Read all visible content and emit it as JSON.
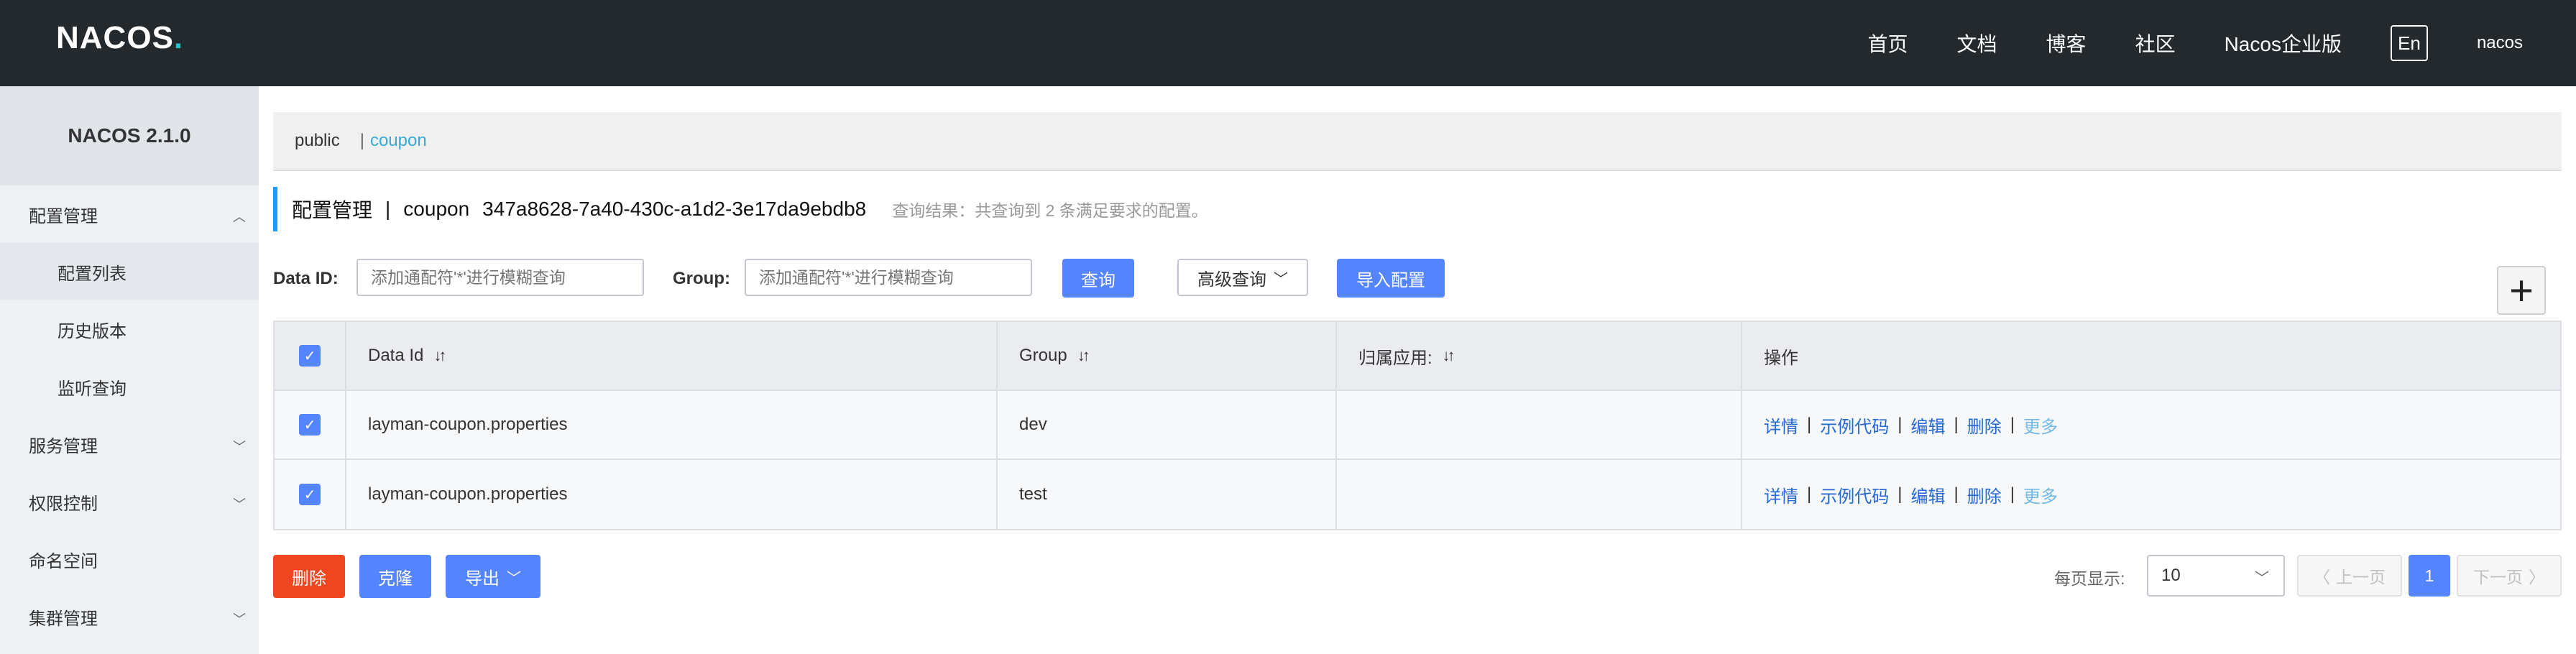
{
  "brand": {
    "logo_text": "NACOS",
    "logo_dot": "."
  },
  "topnav": {
    "items": [
      "首页",
      "文档",
      "博客",
      "社区",
      "Nacos企业版"
    ],
    "lang": "En",
    "user": "nacos"
  },
  "sidebar": {
    "version": "NACOS 2.1.0",
    "items": [
      {
        "label": "配置管理",
        "icon": "chevron-up-icon"
      },
      {
        "label": "配置列表"
      },
      {
        "label": "历史版本"
      },
      {
        "label": "监听查询"
      },
      {
        "label": "服务管理",
        "icon": "chevron-down-icon"
      },
      {
        "label": "权限控制",
        "icon": "chevron-down-icon"
      },
      {
        "label": "命名空间"
      },
      {
        "label": "集群管理",
        "icon": "chevron-down-icon"
      }
    ]
  },
  "namespaces": {
    "items": [
      "public",
      "coupon"
    ],
    "separator": "|",
    "active": "coupon"
  },
  "title": {
    "main": "配置管理",
    "sep": "|",
    "ns_name": "coupon",
    "ns_id": "347a8628-7a40-430c-a1d2-3e17da9ebdb8",
    "result": "查询结果：共查询到 2 条满足要求的配置。"
  },
  "search": {
    "dataid_label": "Data ID:",
    "dataid_placeholder": "添加通配符'*'进行模糊查询",
    "group_label": "Group:",
    "group_placeholder": "添加通配符'*'进行模糊查询",
    "query_btn": "查询",
    "advanced_btn": "高级查询",
    "import_btn": "导入配置",
    "add_icon": "plus-icon"
  },
  "table": {
    "headers": [
      "Data Id",
      "Group",
      "归属应用:",
      "操作"
    ],
    "rows": [
      {
        "data_id": "layman-coupon.properties",
        "group": "dev",
        "app": ""
      },
      {
        "data_id": "layman-coupon.properties",
        "group": "test",
        "app": ""
      }
    ],
    "ops": {
      "detail": "详情",
      "sample": "示例代码",
      "edit": "编辑",
      "delete": "删除",
      "more": "更多",
      "bar": "|"
    },
    "checked_mark": "✓"
  },
  "bottom": {
    "delete_btn": "删除",
    "clone_btn": "克隆",
    "export_btn": "导出",
    "per_page_label": "每页显示:",
    "per_page_value": "10",
    "prev_btn": "上一页",
    "next_btn": "下一页",
    "current_page": "1"
  },
  "colors": {
    "topbar": "#24292e",
    "primary": "#5584ff",
    "danger": "#f0461f",
    "link": "#2468d6",
    "accent": "#39a9d3"
  }
}
